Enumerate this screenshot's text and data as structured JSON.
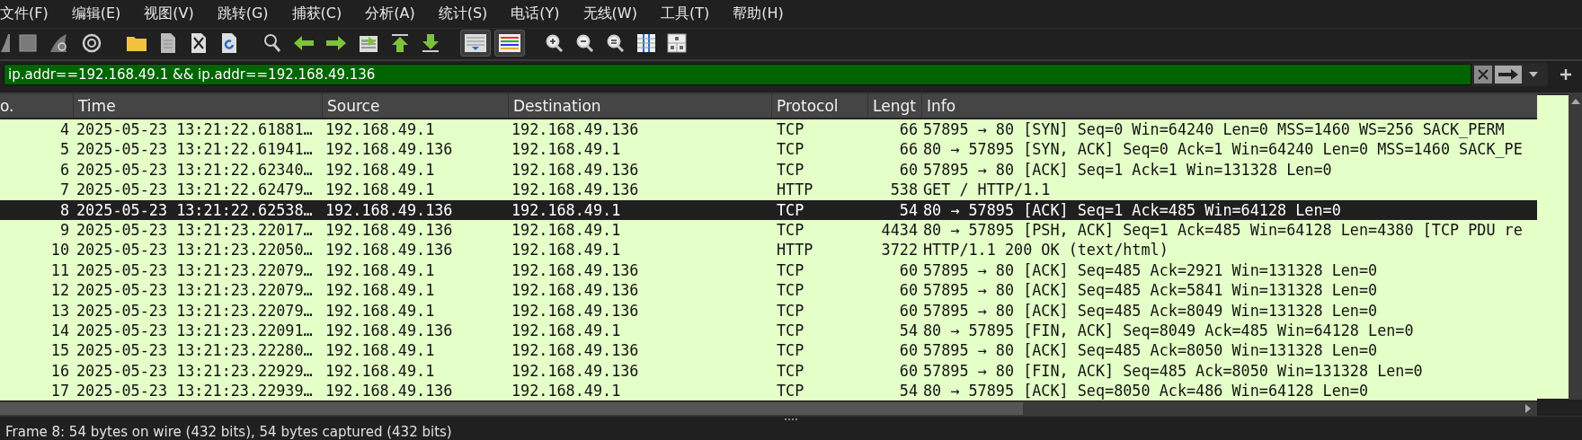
{
  "menu": [
    "文件(F)",
    "编辑(E)",
    "视图(V)",
    "跳转(G)",
    "捕获(C)",
    "分析(A)",
    "统计(S)",
    "电话(Y)",
    "无线(W)",
    "工具(T)",
    "帮助(H)"
  ],
  "toolbar": [
    {
      "on": false
    },
    {
      "on": false
    },
    {
      "on": false
    },
    {
      "on": false
    },
    {
      "on": false
    },
    {
      "on": false
    },
    {
      "on": false
    },
    {
      "on": false
    },
    {
      "on": false
    },
    {
      "on": false
    },
    {
      "on": false
    },
    {
      "on": false
    },
    {
      "on": false
    },
    {
      "on": false
    },
    {
      "on": true
    },
    {
      "on": true
    },
    {
      "on": false
    },
    {
      "on": false
    },
    {
      "on": false
    },
    {
      "on": false
    },
    {
      "on": false
    }
  ],
  "filter": {
    "value": "ip.addr==192.168.49.1 && ip.addr==192.168.49.136",
    "valid": true
  },
  "table": {
    "columns": [
      "o.",
      "Time",
      "Source",
      "Destination",
      "Protocol",
      "Lengt",
      "Info"
    ],
    "rows": [
      {
        "cells": [
          "4",
          "2025-05-23 13:21:22.61881…",
          "192.168.49.1",
          "192.168.49.136",
          "TCP",
          "66",
          "57895 → 80 [SYN] Seq=0 Win=64240 Len=0 MSS=1460 WS=256 SACK_PERM"
        ],
        "selected": false
      },
      {
        "cells": [
          "5",
          "2025-05-23 13:21:22.61941…",
          "192.168.49.136",
          "192.168.49.1",
          "TCP",
          "66",
          "80 → 57895 [SYN, ACK] Seq=0 Ack=1 Win=64240 Len=0 MSS=1460 SACK_PE"
        ],
        "selected": false
      },
      {
        "cells": [
          "6",
          "2025-05-23 13:21:22.62340…",
          "192.168.49.1",
          "192.168.49.136",
          "TCP",
          "60",
          "57895 → 80 [ACK] Seq=1 Ack=1 Win=131328 Len=0"
        ],
        "selected": false
      },
      {
        "cells": [
          "7",
          "2025-05-23 13:21:22.62479…",
          "192.168.49.1",
          "192.168.49.136",
          "HTTP",
          "538",
          "GET / HTTP/1.1"
        ],
        "selected": false
      },
      {
        "cells": [
          "8",
          "2025-05-23 13:21:22.62538…",
          "192.168.49.136",
          "192.168.49.1",
          "TCP",
          "54",
          "80 → 57895 [ACK] Seq=1 Ack=485 Win=64128 Len=0"
        ],
        "selected": true
      },
      {
        "cells": [
          "9",
          "2025-05-23 13:21:23.22017…",
          "192.168.49.136",
          "192.168.49.1",
          "TCP",
          "4434",
          "80 → 57895 [PSH, ACK] Seq=1 Ack=485 Win=64128 Len=4380 [TCP PDU re"
        ],
        "selected": false
      },
      {
        "cells": [
          "10",
          "2025-05-23 13:21:23.22050…",
          "192.168.49.136",
          "192.168.49.1",
          "HTTP",
          "3722",
          "HTTP/1.1 200 OK  (text/html)"
        ],
        "selected": false
      },
      {
        "cells": [
          "11",
          "2025-05-23 13:21:23.22079…",
          "192.168.49.1",
          "192.168.49.136",
          "TCP",
          "60",
          "57895 → 80 [ACK] Seq=485 Ack=2921 Win=131328 Len=0"
        ],
        "selected": false
      },
      {
        "cells": [
          "12",
          "2025-05-23 13:21:23.22079…",
          "192.168.49.1",
          "192.168.49.136",
          "TCP",
          "60",
          "57895 → 80 [ACK] Seq=485 Ack=5841 Win=131328 Len=0"
        ],
        "selected": false
      },
      {
        "cells": [
          "13",
          "2025-05-23 13:21:23.22079…",
          "192.168.49.1",
          "192.168.49.136",
          "TCP",
          "60",
          "57895 → 80 [ACK] Seq=485 Ack=8049 Win=131328 Len=0"
        ],
        "selected": false
      },
      {
        "cells": [
          "14",
          "2025-05-23 13:21:23.22091…",
          "192.168.49.136",
          "192.168.49.1",
          "TCP",
          "54",
          "80 → 57895 [FIN, ACK] Seq=8049 Ack=485 Win=64128 Len=0"
        ],
        "selected": false
      },
      {
        "cells": [
          "15",
          "2025-05-23 13:21:23.22280…",
          "192.168.49.1",
          "192.168.49.136",
          "TCP",
          "60",
          "57895 → 80 [ACK] Seq=485 Ack=8050 Win=131328 Len=0"
        ],
        "selected": false
      },
      {
        "cells": [
          "16",
          "2025-05-23 13:21:23.22929…",
          "192.168.49.1",
          "192.168.49.136",
          "TCP",
          "60",
          "57895 → 80 [FIN, ACK] Seq=485 Ack=8050 Win=131328 Len=0"
        ],
        "selected": false
      },
      {
        "cells": [
          "17",
          "2025-05-23 13:21:23.22939…",
          "192.168.49.136",
          "192.168.49.1",
          "TCP",
          "54",
          "80 → 57895 [ACK] Seq=8050 Ack=486 Win=64128 Len=0"
        ],
        "selected": false
      }
    ]
  },
  "status_bar": "Frame 8: 54 bytes on wire (432 bits), 54 bytes captured (432 bits)"
}
